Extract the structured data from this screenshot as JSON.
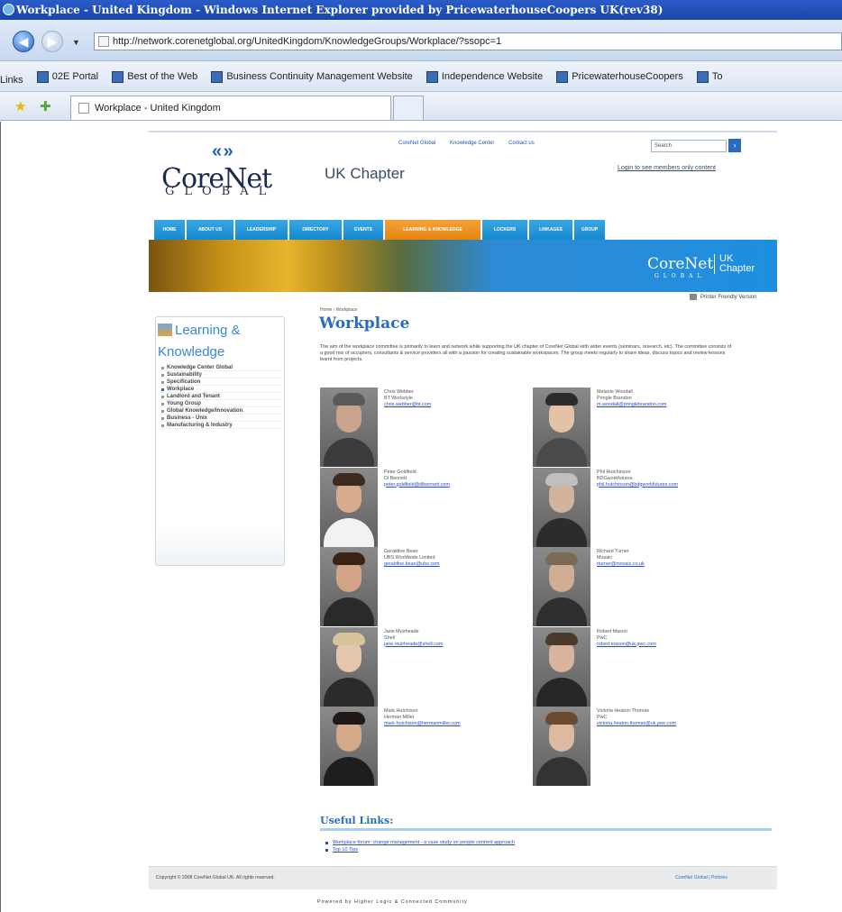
{
  "browser": {
    "title": "Workplace - United Kingdom - Windows Internet Explorer provided by PricewaterhouseCoopers UK(rev38)",
    "url": "http://network.corenetglobal.org/UnitedKingdom/KnowledgeGroups/Workplace/?ssopc=1",
    "links_label": "Links",
    "links": [
      "02E Portal",
      "Best of the Web",
      "Business Continuity Management Website",
      "Independence Website",
      "PricewaterhouseCoopers",
      "To"
    ],
    "tab_title": "Workplace - United Kingdom"
  },
  "site": {
    "logo_main": "CoreNet",
    "logo_sub": "GLOBAL",
    "chapter": "UK Chapter",
    "top_links": [
      "CoreNet Global",
      "Knowledge Center",
      "Contact us"
    ],
    "search_placeholder": "Search",
    "search_go": "›",
    "login_link": "Login to see members only content",
    "nav": [
      "HOME",
      "ABOUT US",
      "LEADERSHIP",
      "DIRECTORY",
      "EVENTS",
      "LEARNING & KNOWLEDGE",
      "LOCKERS",
      "LINKAGES",
      "GROUP"
    ],
    "nav_active": 5,
    "banner_logo": "CoreNet",
    "banner_logo_sub": "GLOBAL",
    "banner_uk": "UK",
    "banner_chapter": "Chapter",
    "printer_friendly": "Printer Friendly Version"
  },
  "sidebar": {
    "heading_1": "Learning &",
    "heading_2": "Knowledge",
    "items": [
      "Knowledge Center Global",
      "Sustainability",
      "Specification",
      "Workplace",
      "Landlord and Tenant",
      "Young Group",
      "Global Knowledge/Innovation",
      "Business - Unix",
      "Manufacturing & Industry"
    ]
  },
  "main": {
    "breadcrumb": "Home › Workplace",
    "title": "Workplace",
    "intro": "The aim of the workplace committee is primarily to learn and network while supporting the UK chapter of CoreNet Global with wider events (seminars, research, etc). The committee consists of a good mix of occupiers, consultants & service providers all with a passion for creating sustainable workspaces. The group meets regularly to share ideas, discuss topics and review lessons learnt from projects.",
    "people": [
      {
        "name": "Chris Webber",
        "company": "BT Workstyle",
        "email": "chris.webber@bt.com"
      },
      {
        "name": "Melanie Woodall",
        "company": "Pringle Brandon",
        "email": "m.woodall@pringlebrandon.com"
      },
      {
        "name": "Peter Goldfield",
        "company": "Di Bennett",
        "email": "peter.goldfield@dibennett.com"
      },
      {
        "name": "Phil Hutchinson",
        "company": "BDGworkfutures",
        "email": "phil.hutchinson@bdgworkfutures.com"
      },
      {
        "name": "Geraldine Bean",
        "company": "UBS Worldwide Limited",
        "email": "geraldine.bean@ubs.com"
      },
      {
        "name": "Richard Turner",
        "company": "Mosaic",
        "email": "rturner@mosaic.co.uk"
      },
      {
        "name": "Jane Muirheade",
        "company": "Shell",
        "email": "jane.muirheade@shell.com"
      },
      {
        "name": "Robert Mason",
        "company": "PwC",
        "email": "robert.mason@uk.pwc.com"
      },
      {
        "name": "Mark Hutchison",
        "company": "Herman Miller",
        "email": "mark.hutchison@hermanmiller.com"
      },
      {
        "name": "Victoria Heaton-Thomas",
        "company": "PwC",
        "email": "victoria.heaton.thomas@uk.pwc.com"
      }
    ],
    "useful_title": "Useful Links:",
    "useful_links": [
      "Workplace forum: change management - a case study on people centred approach",
      "Top 10 Tips"
    ]
  },
  "footer": {
    "copyright": "Copyright © 2008 CoreNet Global UK. All rights reserved.",
    "links": [
      "CoreNet Global",
      "Policies"
    ],
    "powered": "Powered by Higher Logic & Connected Community"
  },
  "colors": {
    "accent": "#2a6bbf",
    "nav_blue": "#1489cf",
    "nav_active": "#e58410",
    "title_bar": "#1a44a8"
  }
}
